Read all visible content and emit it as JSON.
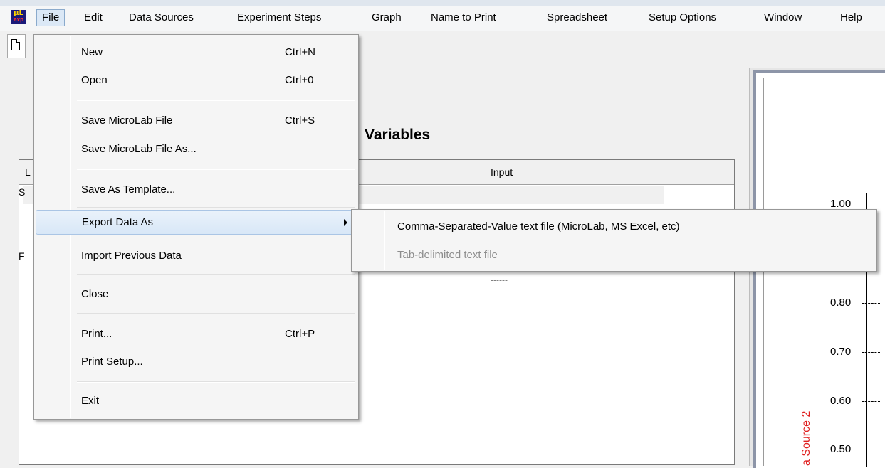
{
  "app": {
    "icon_text": "µL",
    "icon_subtext": "exp"
  },
  "menubar": {
    "items": [
      "File",
      "Edit",
      "Data Sources",
      "Experiment Steps",
      "Graph",
      "Name to Print",
      "Spreadsheet",
      "Setup Options",
      "Window",
      "Help"
    ],
    "active": "File"
  },
  "toolbar": {
    "new_icon": "new-document-icon"
  },
  "variables_panel": {
    "title": "Variables",
    "columns": [
      "L",
      "Input"
    ],
    "row_labels": [
      "S",
      "F"
    ],
    "dashes": "------"
  },
  "graph": {
    "y_ticks": [
      "1.00",
      "0.80",
      "0.70",
      "0.60",
      "0.50"
    ],
    "y_label": "a Source 2",
    "y_label_color": "#e02020"
  },
  "file_menu": {
    "groups": [
      [
        {
          "label": "New",
          "shortcut": "Ctrl+N"
        },
        {
          "label": "Open",
          "shortcut": "Ctrl+0"
        }
      ],
      [
        {
          "label": "Save MicroLab File",
          "shortcut": "Ctrl+S"
        },
        {
          "label": "Save MicroLab File As...",
          "shortcut": ""
        }
      ],
      [
        {
          "label": "Save As Template...",
          "shortcut": ""
        }
      ],
      [
        {
          "label": "Export Data As",
          "shortcut": "",
          "submenu": true,
          "highlighted": true
        },
        {
          "label": "Import Previous Data",
          "shortcut": ""
        }
      ],
      [
        {
          "label": "Close",
          "shortcut": ""
        }
      ],
      [
        {
          "label": "Print...",
          "shortcut": "Ctrl+P"
        },
        {
          "label": "Print Setup...",
          "shortcut": ""
        }
      ],
      [
        {
          "label": "Exit",
          "shortcut": ""
        }
      ]
    ]
  },
  "export_submenu": {
    "items": [
      {
        "label": "Comma-Separated-Value  text file (MicroLab, MS Excel, etc)",
        "enabled": true
      },
      {
        "label": "Tab-delimited text file",
        "enabled": false
      }
    ]
  }
}
